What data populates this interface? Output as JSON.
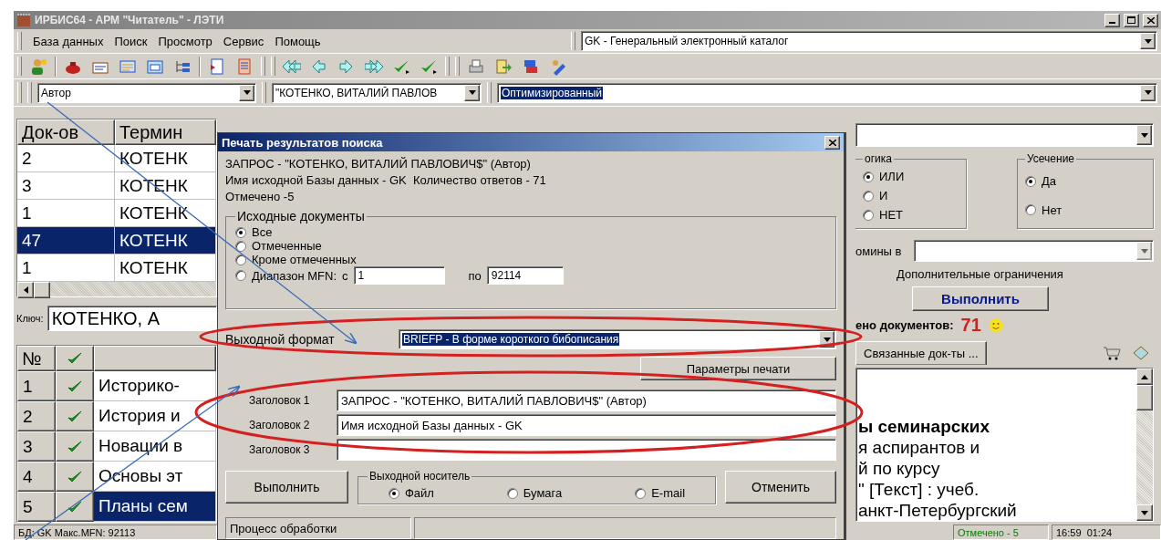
{
  "window": {
    "title": "ИРБИС64 - АРМ \"Читатель\" - ЛЭТИ"
  },
  "menu": [
    "База данных",
    "Поиск",
    "Просмотр",
    "Сервис",
    "Помощь"
  ],
  "database": {
    "value": "GK - Генеральный электронный каталог"
  },
  "search_bar": {
    "field": "Автор",
    "term": "\"КОТЕНКО, ВИТАЛИЙ ПАВЛОВ",
    "mode": "Оптимизированный"
  },
  "terms_table": {
    "columns": [
      "Док-ов",
      "Термин"
    ],
    "rows": [
      {
        "count": "2",
        "term": "КОТЕНК",
        "selected": false
      },
      {
        "count": "3",
        "term": "КОТЕНК",
        "selected": false
      },
      {
        "count": "1",
        "term": "КОТЕНК",
        "selected": false
      },
      {
        "count": "47",
        "term": "КОТЕНК",
        "selected": true
      },
      {
        "count": "1",
        "term": "КОТЕНК",
        "selected": false
      }
    ]
  },
  "key": {
    "label": "Ключ:",
    "value": "КОТЕНКО, А"
  },
  "docs_table": {
    "columns": [
      "№"
    ],
    "rows": [
      {
        "number": "1",
        "checked": true,
        "title": "Историко-",
        "selected": false
      },
      {
        "number": "2",
        "checked": true,
        "title": "История и",
        "selected": false
      },
      {
        "number": "3",
        "checked": true,
        "title": "Новации в",
        "selected": false
      },
      {
        "number": "4",
        "checked": true,
        "title": "Основы эт",
        "selected": false
      },
      {
        "number": "5",
        "checked": true,
        "title": "Планы сем",
        "selected": true
      }
    ]
  },
  "right_panel": {
    "logic": {
      "title": "огика",
      "options": [
        {
          "label": "ИЛИ",
          "selected": true
        },
        {
          "label": "И",
          "selected": false
        },
        {
          "label": "НЕТ",
          "selected": false
        }
      ]
    },
    "truncation": {
      "title": "Усечение",
      "options": [
        {
          "label": "Да",
          "selected": true
        },
        {
          "label": "Нет",
          "selected": false
        }
      ]
    },
    "terms_in_label": "омины в",
    "extra_label": "Дополнительные ограничения",
    "run_button": "Выполнить",
    "found": {
      "label": "ено документов:",
      "count": "71"
    },
    "tab": "Связанные док-ты ...",
    "text_lines": [
      {
        "text": "ы семинарских",
        "bold": true
      },
      {
        "text": "я аспирантов и",
        "bold": false
      },
      {
        "text": "й по курсу",
        "bold": false
      },
      {
        "text": "\" [Текст] : учеб.",
        "bold": false
      },
      {
        "text": "анкт-Петербургский",
        "bold": false
      }
    ]
  },
  "status_bar": {
    "left": "БД: GK Макс.MFN: 92113",
    "marked": "Отмечено - 5",
    "time": "16:59  01:24"
  },
  "dialog": {
    "title": "Печать результатов поиска",
    "info": [
      "ЗАПРОС - \"КОТЕНКО, ВИТАЛИЙ ПАВЛОВИЧ$\" (Автор)",
      "Имя исходной Базы данных - GK  Количество ответов - 71",
      "Отмечено -5"
    ],
    "source": {
      "title": "Исходные документы",
      "options": [
        {
          "label": "Все",
          "selected": true
        },
        {
          "label": "Отмеченные",
          "selected": false
        },
        {
          "label": "Кроме отмеченных",
          "selected": false
        },
        {
          "label": "Диапазон MFN:",
          "selected": false
        }
      ],
      "from_label": "с",
      "from": "1",
      "to_label": "по",
      "to": "92114"
    },
    "format": {
      "label": "Выходной формат",
      "value": "BRIEFP - В форме короткого бибописания"
    },
    "params_button": "Параметры печати",
    "headers": [
      {
        "label": "Заголовок 1",
        "value": "ЗАПРОС - \"КОТЕНКО, ВИТАЛИЙ ПАВЛОВИЧ$\" (Автор)"
      },
      {
        "label": "Заголовок 2",
        "value": "Имя исходной Базы данных - GK"
      },
      {
        "label": "Заголовок 3"
      }
    ],
    "run_button": "Выполнить",
    "output": {
      "title": "Выходной носитель",
      "options": [
        {
          "label": "Файл",
          "selected": true
        },
        {
          "label": "Бумага",
          "selected": false
        },
        {
          "label": "E-mail",
          "selected": false
        }
      ]
    },
    "cancel_button": "Отменить",
    "progress_label": "Процесс обработки"
  }
}
